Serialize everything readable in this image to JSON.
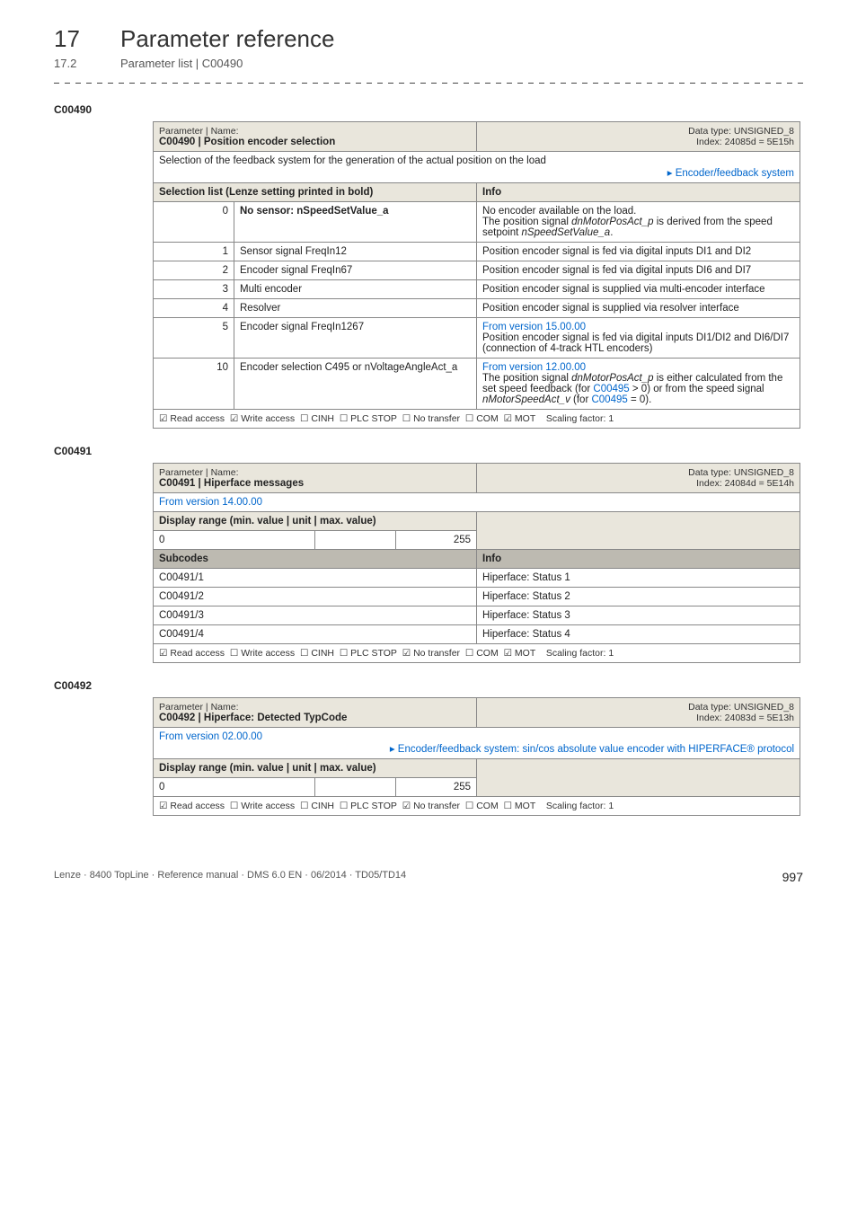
{
  "header": {
    "chapnum": "17",
    "chaptitle": "Parameter reference",
    "subnum": "17.2",
    "subtitle": "Parameter list | C00490"
  },
  "p490": {
    "code": "C00490",
    "label": "Parameter | Name:",
    "name": "C00490 | Position encoder selection",
    "dtype": "Data type: UNSIGNED_8",
    "index": "Index: 24085d = 5E15h",
    "desc": "Selection of the feedback system for the generation of the actual position on the load",
    "desc_link": "Encoder/feedback system",
    "listhdr": "Selection list (Lenze setting printed in bold)",
    "infohdr": "Info",
    "rows": [
      {
        "n": "0",
        "label_bold": "No sensor: nSpeedSetValue_a",
        "info_html": "No encoder available on the load.<br>The position signal <span class='italic'>dnMotorPosAct_p</span> is derived from the speed setpoint <span class='italic'>nSpeedSetValue_a</span>."
      },
      {
        "n": "1",
        "label": "Sensor signal FreqIn12",
        "info_html": "Position encoder signal is fed via digital inputs DI1 and DI2"
      },
      {
        "n": "2",
        "label": "Encoder signal FreqIn67",
        "info_html": "Position encoder signal is fed via digital inputs DI6 and DI7"
      },
      {
        "n": "3",
        "label": "Multi encoder",
        "info_html": "Position encoder signal is supplied via multi-encoder interface"
      },
      {
        "n": "4",
        "label": "Resolver",
        "info_html": "Position encoder signal is supplied via resolver interface"
      },
      {
        "n": "5",
        "label": "Encoder signal FreqIn1267",
        "info_html": "<span class='link'>From version 15.00.00</span><br>Position encoder signal is fed via digital inputs DI1/DI2 and DI6/DI7 (connection of 4-track HTL encoders)"
      },
      {
        "n": "10",
        "label": "Encoder selection C495 or nVoltageAngleAct_a",
        "info_html": "<span class='link'>From version 12.00.00</span><br>The position signal <span class='italic'>dnMotorPosAct_p</span> is either calculated from the set speed feedback (for <span class='link'>C00495</span> &gt; 0) or from the speed signal <span class='italic'>nMotorSpeedAct_v</span> (for <span class='link'>C00495</span> = 0)."
      }
    ],
    "foot_html": "<span class='chk'></span>Read access&nbsp;&nbsp;<span class='chk'></span>Write access&nbsp;&nbsp;<span class='unchk'></span>CINH&nbsp;&nbsp;<span class='unchk'></span>PLC STOP&nbsp;&nbsp;<span class='unchk'></span>No transfer&nbsp;&nbsp;<span class='unchk'></span>COM&nbsp;&nbsp;<span class='chk'></span>MOT&nbsp;&nbsp;&nbsp;&nbsp;Scaling factor: 1"
  },
  "p491": {
    "code": "C00491",
    "label": "Parameter | Name:",
    "name": "C00491 | Hiperface messages",
    "dtype": "Data type: UNSIGNED_8",
    "index": "Index: 24084d = 5E14h",
    "from": "From version 14.00.00",
    "rangehdr": "Display range (min. value | unit | max. value)",
    "min": "0",
    "max": "255",
    "subhdr": "Subcodes",
    "infohdr": "Info",
    "rows": [
      {
        "s": "C00491/1",
        "i": "Hiperface: Status 1"
      },
      {
        "s": "C00491/2",
        "i": "Hiperface: Status 2"
      },
      {
        "s": "C00491/3",
        "i": "Hiperface: Status 3"
      },
      {
        "s": "C00491/4",
        "i": "Hiperface: Status 4"
      }
    ],
    "foot_html": "<span class='chk'></span>Read access&nbsp;&nbsp;<span class='unchk'></span>Write access&nbsp;&nbsp;<span class='unchk'></span>CINH&nbsp;&nbsp;<span class='unchk'></span>PLC STOP&nbsp;&nbsp;<span class='chk'></span>No transfer&nbsp;&nbsp;<span class='unchk'></span>COM&nbsp;&nbsp;<span class='chk'></span>MOT&nbsp;&nbsp;&nbsp;&nbsp;Scaling factor: 1"
  },
  "p492": {
    "code": "C00492",
    "label": "Parameter | Name:",
    "name": "C00492 | Hiperface: Detected TypCode",
    "dtype": "Data type: UNSIGNED_8",
    "index": "Index: 24083d = 5E13h",
    "from": "From version 02.00.00",
    "desc_link": "Encoder/feedback system: sin/cos absolute value encoder with HIPERFACE® protocol",
    "rangehdr": "Display range (min. value | unit | max. value)",
    "min": "0",
    "max": "255",
    "foot_html": "<span class='chk'></span>Read access&nbsp;&nbsp;<span class='unchk'></span>Write access&nbsp;&nbsp;<span class='unchk'></span>CINH&nbsp;&nbsp;<span class='unchk'></span>PLC STOP&nbsp;&nbsp;<span class='chk'></span>No transfer&nbsp;&nbsp;<span class='unchk'></span>COM&nbsp;&nbsp;<span class='unchk'></span>MOT&nbsp;&nbsp;&nbsp;&nbsp;Scaling factor: 1"
  },
  "footer": {
    "left": "Lenze · 8400 TopLine · Reference manual · DMS 6.0 EN · 06/2014 · TD05/TD14",
    "page": "997"
  }
}
